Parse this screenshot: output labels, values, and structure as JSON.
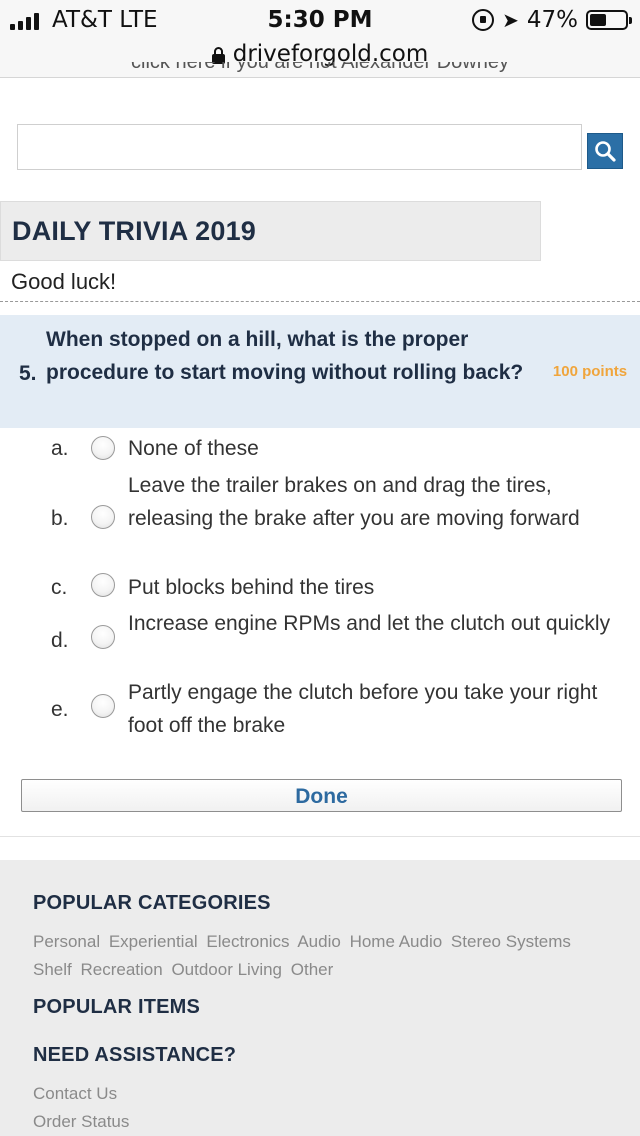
{
  "status_bar": {
    "carrier": "AT&T  LTE",
    "time": "5:30 PM",
    "battery": "47%",
    "battery_level": 0.47
  },
  "url_bar": {
    "url": "driveforgold.com"
  },
  "cut_link_text": "click here if you are not Alexander Downey",
  "search": {
    "value": "",
    "placeholder": "",
    "icon": "search-icon"
  },
  "trivia": {
    "title": "DAILY TRIVIA 2019",
    "greeting": "Good luck!"
  },
  "question": {
    "number": "5.",
    "text": "When stopped on a hill, what is the proper procedure to start moving without rolling back?",
    "points": "100 points",
    "answers": [
      {
        "letter": "a.",
        "text": "None of these"
      },
      {
        "letter": "b.",
        "text": "Leave the trailer brakes on and drag the tires, releasing the brake after you are moving forward"
      },
      {
        "letter": "c.",
        "text": "Put blocks behind the tires"
      },
      {
        "letter": "d.",
        "text": "Increase engine RPMs and let the clutch out quickly"
      },
      {
        "letter": "e.",
        "text": "Partly engage the clutch before you take your right foot off the brake"
      }
    ],
    "done_label": "Done"
  },
  "footer": {
    "popular_categories_heading": "POPULAR CATEGORIES",
    "categories": [
      "Personal",
      "Experiential",
      "Electronics",
      "Audio",
      "Home Audio",
      "Stereo Systems",
      "Shelf",
      "Recreation",
      "Outdoor Living",
      "Other"
    ],
    "popular_items_heading": "POPULAR ITEMS",
    "need_assistance_heading": "NEED ASSISTANCE?",
    "assistance_links": [
      "Contact Us",
      "Order Status"
    ]
  },
  "colors": {
    "brand_navy": "#1f2e44",
    "points_orange": "#f0a53c",
    "search_button_blue": "#2b6fa6",
    "question_bg": "#e3ecf5"
  }
}
